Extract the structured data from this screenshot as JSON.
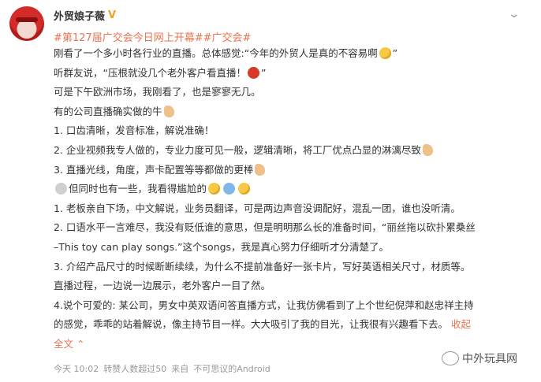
{
  "post": {
    "username": "外贸娘子薇",
    "hashtag": "#第127届广交会今日网上开幕##广交会#",
    "lines": [
      "刚看了一个多小时各行业的直播。总体感觉:“今年的外贸人是真的不容易啊",
      "听群友说，“压根就没几个老外客户看直播！",
      "可是下午欧洲市场，我刚看了，也是寥寥无几。",
      "有的公司直播确实做的牛",
      "1. 口齿清晰，发音标准，解说准确！",
      "2. 企业视频我专人做的，专业力度可见一般，逻辑清晰，将工厂优点凸显的淋漓尽致",
      "3. 直播光线，角度，声卡配置等等都做的更棒",
      "但同时也有一些，我看得尴尬的",
      "1. 老板亲自下场，中文解说，业务员翻译，可是两边声音没调配好，混乱一团，谁也没听清。",
      "2. 口语水平一言难尽，我没有贬低谁的意思，但是明明那么长的准备时间，“丽丝拖以砍扑累桑丝",
      "–This toy can play songs.”这个songs，我是真心努力仔细听才分清楚了。",
      "3. 介绍产品尺寸的时候断断续续，为什么不提前准备好一张卡片，写好英语相关尺寸，材质等。",
      "直播过程，一边说一边展示，老外客户一目了然。",
      "4.说个可爱的: 某公司，男女中英双语问答直播方式，让我仿佛看到了上个世纪倪萍和赵忠祥主持",
      "的感觉，乖乖的站着解说，像主持节目一样。大大吸引了我的目光，让我很有兴趣看下去。",
      "全文"
    ],
    "collapse_link": "收起",
    "footer": {
      "time": "今天 10:02",
      "likes": "转赞人数超过50",
      "source_prefix": "来自",
      "source": "不可思议的Android"
    },
    "watermark": "中外玩具网"
  }
}
